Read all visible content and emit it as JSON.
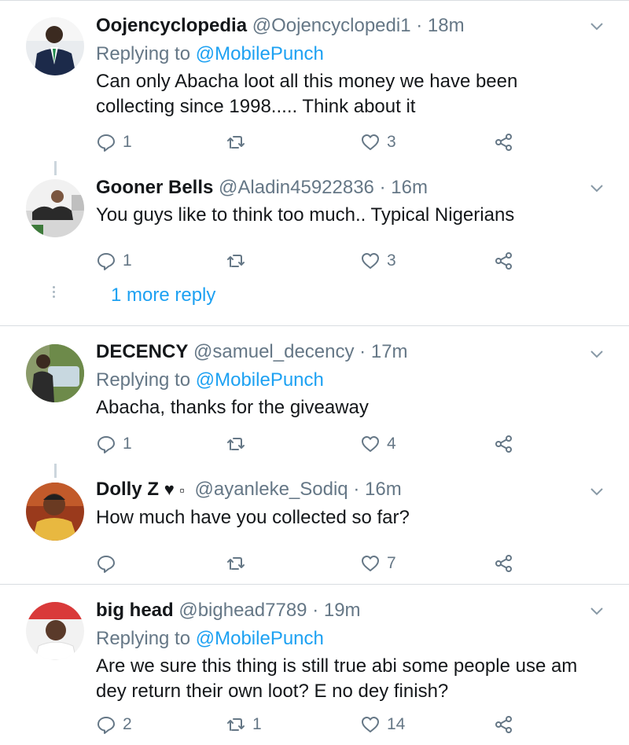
{
  "tweets": [
    {
      "name": "Oojencyclopedia",
      "handle": "@Oojencyclopedi1",
      "time": "18m",
      "replying_label": "Replying to",
      "replying_to": "@MobilePunch",
      "text": "Can only Abacha loot all this money we have been collecting since 1998..... Think about it",
      "replies": "1",
      "retweets": "",
      "likes": "3"
    },
    {
      "name": "Gooner Bells",
      "handle": "@Aladin45922836",
      "time": "16m",
      "text": "You guys like to think too much.. Typical Nigerians",
      "replies": "1",
      "retweets": "",
      "likes": "3"
    },
    {
      "name": "DECENCY",
      "handle": "@samuel_decency",
      "time": "17m",
      "replying_label": "Replying to",
      "replying_to": "@MobilePunch",
      "text": "Abacha, thanks for the giveaway",
      "replies": "1",
      "retweets": "",
      "likes": "4"
    },
    {
      "name": "Dolly Z",
      "name_emoji": "♥",
      "name_extra": "▫",
      "handle": "@ayanleke_Sodiq",
      "time": "16m",
      "text": "How much have you collected so far?",
      "replies": "",
      "retweets": "",
      "likes": "7"
    },
    {
      "name": "big head",
      "handle": "@bighead7789",
      "time": "19m",
      "replying_label": "Replying to",
      "replying_to": "@MobilePunch",
      "text": "Are we sure this thing is still true abi some people use am dey return their own loot? E no dey finish?",
      "replies": "2",
      "retweets": "1",
      "likes": "14"
    }
  ],
  "more_reply": "1 more reply",
  "dot_separator": "·",
  "icons": {
    "reply": "reply-icon",
    "retweet": "retweet-icon",
    "like": "heart-icon",
    "share": "share-icon",
    "caret": "chevron-down-icon"
  },
  "colors": {
    "link": "#1da1f2",
    "secondary": "#657786",
    "divider": "#d9dde1"
  }
}
